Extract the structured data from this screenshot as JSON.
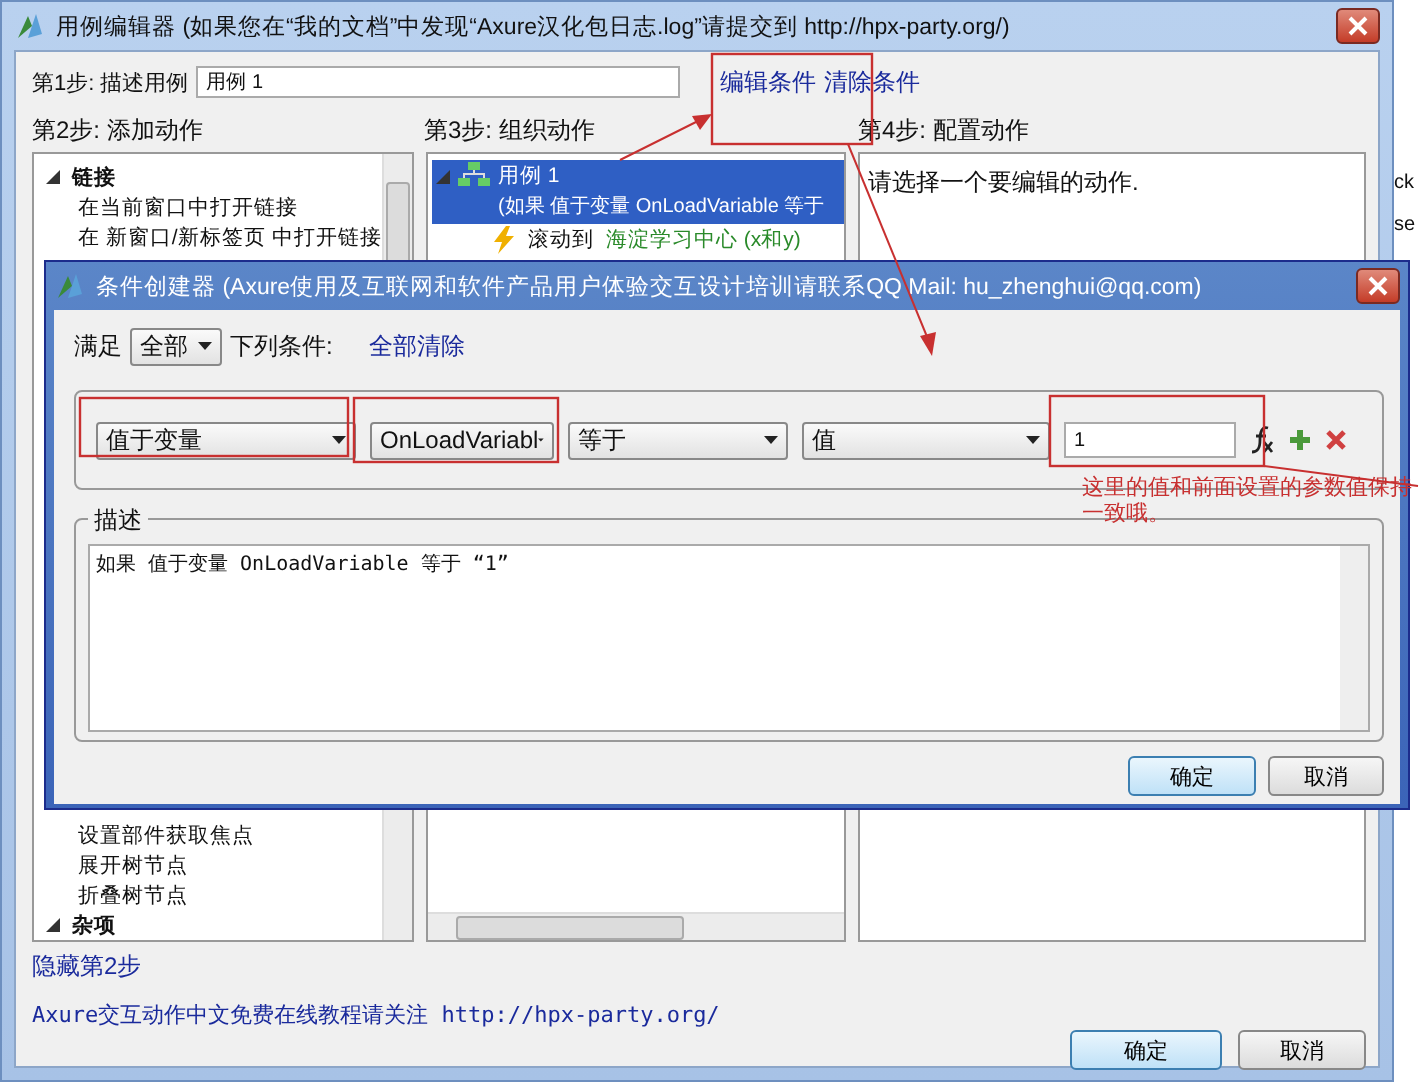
{
  "window": {
    "title": "用例编辑器 (如果您在“我的文档”中发现“Axure汉化包日志.log”请提交到 http://hpx-party.org/)"
  },
  "step1": {
    "label": "第1步: 描述用例",
    "value": "用例 1",
    "links": [
      "编辑条件",
      "清除条件"
    ]
  },
  "step2": {
    "label": "第2步: 添加动作",
    "tree_top": [
      {
        "kind": "group",
        "label": "链接",
        "expanded": true,
        "children": [
          {
            "kind": "action",
            "label": "在当前窗口中打开链接"
          },
          {
            "kind": "action",
            "label": "在 新窗口/新标签页 中打开链接"
          }
        ]
      }
    ],
    "tree_bottom": [
      {
        "kind": "action",
        "label": "设置部件获取焦点"
      },
      {
        "kind": "action",
        "label": "展开树节点"
      },
      {
        "kind": "action",
        "label": "折叠树节点"
      },
      {
        "kind": "group",
        "label": "杂项",
        "expanded": true
      }
    ]
  },
  "step3": {
    "label": "第3步: 组织动作",
    "tree": [
      {
        "label": "用例 1",
        "detail": "(如果 值于变量 OnLoadVariable 等于",
        "selected": true,
        "expanded": true,
        "children": [
          {
            "action": "滚动到",
            "target": "海淀学习中心 (x和y)",
            "selected": false
          }
        ]
      }
    ]
  },
  "step4": {
    "label": "第4步: 配置动作",
    "message": "请选择一个要编辑的动作."
  },
  "hide_step2": "隐藏第2步",
  "footer_note": "Axure交互动作中文免费在线教程请关注 http://hpx-party.org/",
  "buttons": [
    "确定",
    "取消"
  ],
  "background_fragments": [
    "ck",
    "se"
  ],
  "dialog": {
    "title": "条件创建器 (Axure使用及互联网和软件产品用户体验交互设计培训请联系QQ Mail: hu_zhenghui@qq.com)",
    "match_label": "满足",
    "match_value": "全部",
    "match_suffix": "下列条件:",
    "clear_all": "全部清除",
    "condition": [
      {
        "kind": "select",
        "value": "值于变量"
      },
      {
        "kind": "select",
        "value": "OnLoadVariabl"
      },
      {
        "kind": "select",
        "value": "等于"
      },
      {
        "kind": "select",
        "value": "值"
      },
      {
        "kind": "input",
        "value": "1"
      }
    ],
    "description_label": "描述",
    "description": "如果 值于变量 OnLoadVariable 等于 “1”",
    "buttons": [
      "确定",
      "取消"
    ]
  },
  "annotation": "这里的值和前面设置的参数值保持一致哦。"
}
